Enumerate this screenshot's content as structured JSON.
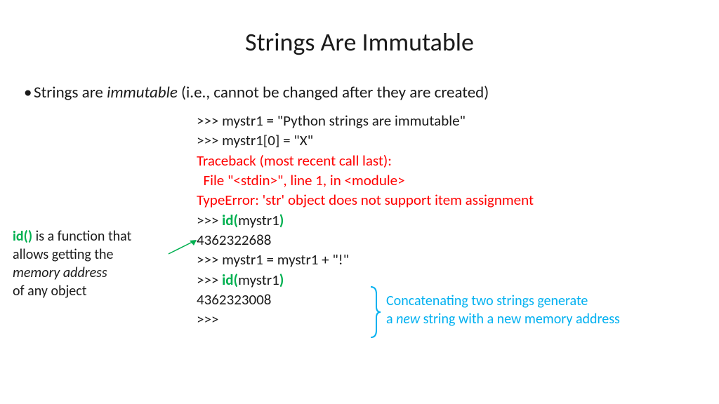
{
  "title": "Strings Are Immutable",
  "bullet": {
    "pre": "Strings are ",
    "em": "immutable",
    "post": " (i.e., cannot be changed after they are created)"
  },
  "code": {
    "l1": ">>> mystr1 = \"Python strings are immutable\"",
    "l2": ">>> mystr1[0] = \"X\"",
    "l3": "Traceback (most recent call last):",
    "l4": "  File \"<stdin>\", line 1, in <module>",
    "l5": "TypeError: 'str' object does not support item assignment",
    "l6a": ">>> ",
    "l6b": "id(",
    "l6c": "mystr1",
    "l6d": ")",
    "l7": "4362322688",
    "l8": ">>> mystr1 = mystr1 + \"!\"",
    "l9a": ">>> ",
    "l9b": "id(",
    "l9c": "mystr1",
    "l9d": ")",
    "l10": "4362323008",
    "l11": ">>>"
  },
  "sidenote": {
    "l1a": "id()",
    "l1b": " is a function that",
    "l2": "allows getting the",
    "l3": "memory address",
    "l4": "of any object"
  },
  "rightnote": {
    "l1": "Concatenating two strings generate",
    "l2a": "a ",
    "l2b": "new",
    "l2c": " string with a new memory address"
  },
  "colors": {
    "error": "#ff0000",
    "green": "#00b050",
    "cyan": "#00b0f0"
  }
}
